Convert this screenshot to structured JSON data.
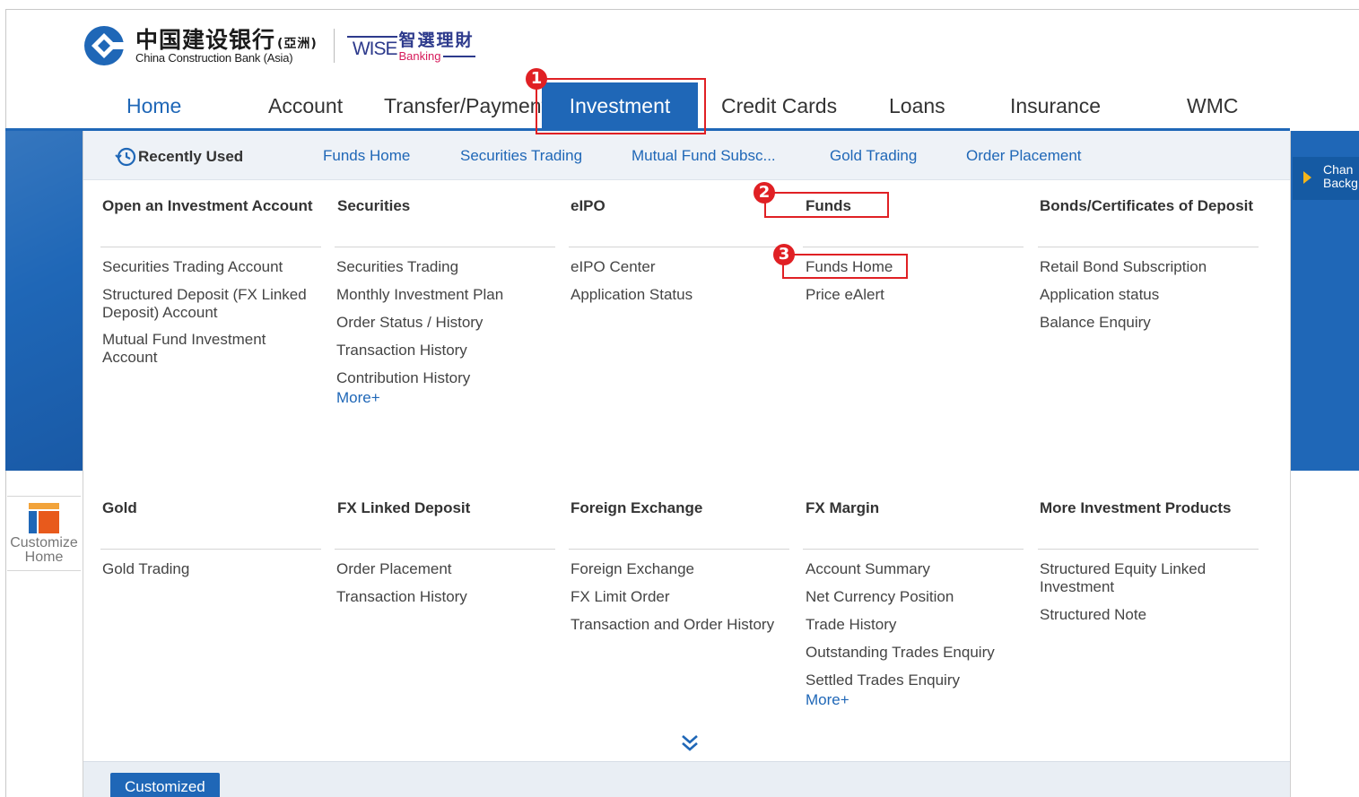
{
  "brand": {
    "chinese_name": "中国建设银行",
    "chinese_suffix": "(亞洲)",
    "english_name": "China Construction Bank (Asia)",
    "wise_word": "WISE",
    "wise_chinese": "智選理財",
    "wise_banking": "Banking",
    "brand_color": "#1f67b7"
  },
  "nav": {
    "items": [
      {
        "label": "Home"
      },
      {
        "label": "Account"
      },
      {
        "label": "Transfer/Payment"
      },
      {
        "label": "Investment",
        "active": true
      },
      {
        "label": "Credit Cards"
      },
      {
        "label": "Loans"
      },
      {
        "label": "Insurance"
      },
      {
        "label": "WMC"
      }
    ]
  },
  "recently_used": {
    "label": "Recently Used",
    "links": [
      "Funds Home",
      "Securities Trading",
      "Mutual Fund Subsc...",
      "Gold Trading",
      "Order Placement"
    ]
  },
  "menu": {
    "columns_top": [
      {
        "heading": "Open an Investment Account",
        "items": [
          "Securities Trading Account",
          "Structured Deposit (FX Linked Deposit) Account",
          "Mutual Fund Investment Account"
        ]
      },
      {
        "heading": "Securities",
        "items": [
          "Securities Trading",
          "Monthly Investment Plan",
          "Order Status / History",
          "Transaction History",
          "Contribution History"
        ],
        "more": "More+"
      },
      {
        "heading": "eIPO",
        "items": [
          "eIPO Center",
          "Application Status"
        ]
      },
      {
        "heading": "Funds",
        "items": [
          "Funds Home",
          "Price eAlert"
        ]
      },
      {
        "heading": "Bonds/Certificates of Deposit",
        "items": [
          "Retail Bond Subscription",
          "Application status",
          "Balance Enquiry"
        ]
      }
    ],
    "columns_bottom": [
      {
        "heading": "Gold",
        "items": [
          "Gold Trading"
        ]
      },
      {
        "heading": "FX Linked Deposit",
        "items": [
          "Order Placement",
          "Transaction History"
        ]
      },
      {
        "heading": "Foreign Exchange",
        "items": [
          "Foreign Exchange",
          "FX Limit Order",
          "Transaction and Order History"
        ]
      },
      {
        "heading": "FX Margin",
        "items": [
          "Account Summary",
          "Net Currency Position",
          "Trade History",
          "Outstanding Trades Enquiry",
          "Settled Trades Enquiry"
        ],
        "more": "More+"
      },
      {
        "heading": "More Investment Products",
        "items": [
          "Structured Equity Linked Investment",
          "Structured Note"
        ]
      }
    ]
  },
  "side": {
    "customize_line1": "Customize",
    "customize_line2": "Home",
    "change_line1": "Chan",
    "change_line2": "Backg"
  },
  "bottom": {
    "customized_label": "Customized"
  },
  "annotations": {
    "badges": [
      "1",
      "2",
      "3"
    ],
    "highlight_color": "#e02024"
  }
}
